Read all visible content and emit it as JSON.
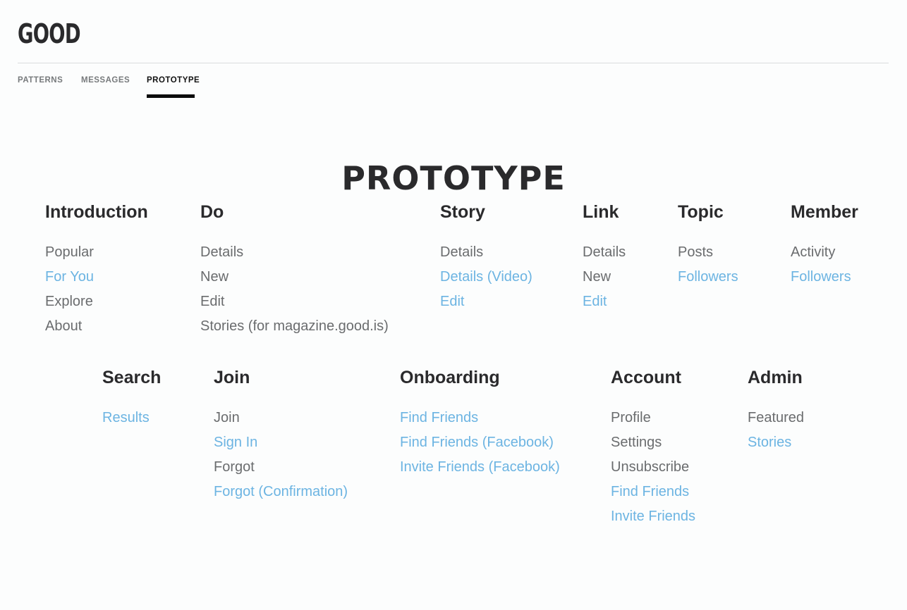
{
  "brand": {
    "logo": "GOOD"
  },
  "tabs": [
    {
      "label": "PATTERNS"
    },
    {
      "label": "MESSAGES"
    },
    {
      "label": "PROTOTYPE"
    }
  ],
  "page_title": "PROTOTYPE",
  "colors": {
    "link_gray": "#6a6c6e",
    "link_blue": "#6cb4e2",
    "heading": "#2a2a2c",
    "active_tab_underline": "#0c0c0c"
  },
  "sections": {
    "introduction": {
      "title": "Introduction",
      "links": [
        "Popular",
        "For You",
        "Explore",
        "About"
      ]
    },
    "do": {
      "title": "Do",
      "links": [
        "Details",
        "New",
        "Edit",
        "Stories (for magazine.good.is)"
      ]
    },
    "story": {
      "title": "Story",
      "links": [
        "Details",
        "Details (Video)",
        "Edit"
      ]
    },
    "link": {
      "title": "Link",
      "links": [
        "Details",
        "New",
        "Edit"
      ]
    },
    "topic": {
      "title": "Topic",
      "links": [
        "Posts",
        "Followers"
      ]
    },
    "member": {
      "title": "Member",
      "links": [
        "Activity",
        "Followers"
      ]
    },
    "search": {
      "title": "Search",
      "links": [
        "Results"
      ]
    },
    "join": {
      "title": "Join",
      "links": [
        "Join",
        "Sign In",
        "Forgot",
        "Forgot (Confirmation)"
      ]
    },
    "onboarding": {
      "title": "Onboarding",
      "links": [
        "Find Friends",
        "Find Friends (Facebook)",
        "Invite Friends (Facebook)"
      ]
    },
    "account": {
      "title": "Account",
      "links": [
        "Profile",
        "Settings",
        "Unsubscribe",
        "Find Friends",
        "Invite Friends"
      ]
    },
    "admin": {
      "title": "Admin",
      "links": [
        "Featured",
        "Stories"
      ]
    }
  }
}
